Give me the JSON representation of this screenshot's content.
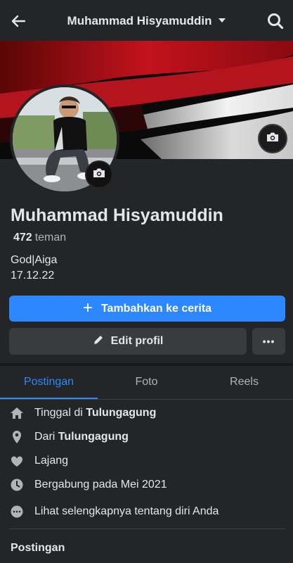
{
  "header": {
    "title": "Muhammad Hisyamuddin",
    "back_icon": "arrow-left-icon",
    "search_icon": "search-icon"
  },
  "profile": {
    "name": "Muhammad Hisyamuddin",
    "friends_count": "472",
    "friends_label": "teman",
    "bio_line1": "God|Aiga",
    "bio_line2": "17.12.22"
  },
  "actions": {
    "add_story": "Tambahkan ke cerita",
    "edit_profile": "Edit profil",
    "more": "•••"
  },
  "tabs": [
    {
      "label": "Postingan",
      "active": true
    },
    {
      "label": "Foto",
      "active": false
    },
    {
      "label": "Reels",
      "active": false
    }
  ],
  "details": {
    "lives_prefix": "Tinggal di ",
    "lives_city": "Tulungagung",
    "from_prefix": "Dari ",
    "from_city": "Tulungagung",
    "relationship": "Lajang",
    "joined": "Bergabung pada Mei 2021",
    "see_more": "Lihat selengkapnya tentang diri Anda"
  },
  "posts_section_title": "Postingan",
  "colors": {
    "background": "#242526",
    "accent": "#2d88ff",
    "button_secondary": "#3a3b3c",
    "text_primary": "#e4e6eb",
    "text_secondary": "#b0b3b8"
  }
}
